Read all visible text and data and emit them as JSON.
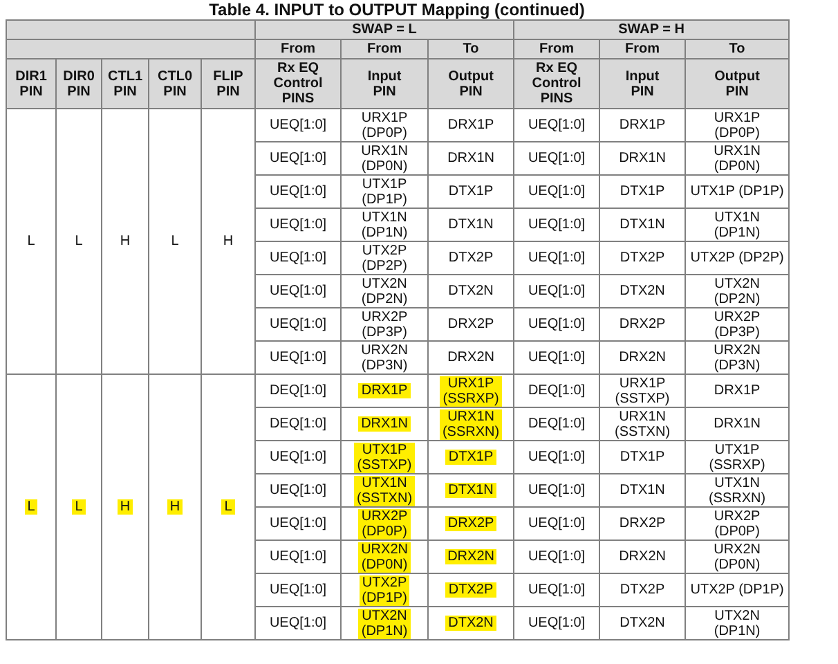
{
  "title": "Table 4. INPUT to OUTPUT Mapping (continued)",
  "swap_groups": [
    "SWAP = L",
    "SWAP = H"
  ],
  "direction_row": [
    "From",
    "From",
    "To",
    "From",
    "From",
    "To"
  ],
  "columns": [
    "DIR1\nPIN",
    "DIR0\nPIN",
    "CTL1\nPIN",
    "CTL0\nPIN",
    "FLIP\nPIN",
    "Rx EQ\nControl\nPINS",
    "Input\nPIN",
    "Output\nPIN",
    "Rx EQ\nControl\nPINS",
    "Input\nPIN",
    "Output\nPIN"
  ],
  "groups": [
    {
      "pins": [
        "L",
        "L",
        "H",
        "L",
        "H"
      ],
      "pins_highlighted": false,
      "rows": [
        {
          "cells": [
            "UEQ[1:0]",
            "URX1P\n(DP0P)",
            "DRX1P",
            "UEQ[1:0]",
            "DRX1P",
            "URX1P\n(DP0P)"
          ],
          "input_highlighted": false,
          "output_highlighted": false
        },
        {
          "cells": [
            "UEQ[1:0]",
            "URX1N\n(DP0N)",
            "DRX1N",
            "UEQ[1:0]",
            "DRX1N",
            "URX1N\n(DP0N)"
          ],
          "input_highlighted": false,
          "output_highlighted": false
        },
        {
          "cells": [
            "UEQ[1:0]",
            "UTX1P\n(DP1P)",
            "DTX1P",
            "UEQ[1:0]",
            "DTX1P",
            "UTX1P (DP1P)"
          ],
          "input_highlighted": false,
          "output_highlighted": false
        },
        {
          "cells": [
            "UEQ[1:0]",
            "UTX1N\n(DP1N)",
            "DTX1N",
            "UEQ[1:0]",
            "DTX1N",
            "UTX1N\n(DP1N)"
          ],
          "input_highlighted": false,
          "output_highlighted": false
        },
        {
          "cells": [
            "UEQ[1:0]",
            "UTX2P\n(DP2P)",
            "DTX2P",
            "UEQ[1:0]",
            "DTX2P",
            "UTX2P (DP2P)"
          ],
          "input_highlighted": false,
          "output_highlighted": false
        },
        {
          "cells": [
            "UEQ[1:0]",
            "UTX2N\n(DP2N)",
            "DTX2N",
            "UEQ[1:0]",
            "DTX2N",
            "UTX2N\n(DP2N)"
          ],
          "input_highlighted": false,
          "output_highlighted": false
        },
        {
          "cells": [
            "UEQ[1:0]",
            "URX2P\n(DP3P)",
            "DRX2P",
            "UEQ[1:0]",
            "DRX2P",
            "URX2P\n(DP3P)"
          ],
          "input_highlighted": false,
          "output_highlighted": false
        },
        {
          "cells": [
            "UEQ[1:0]",
            "URX2N\n(DP3N)",
            "DRX2N",
            "UEQ[1:0]",
            "DRX2N",
            "URX2N\n(DP3N)"
          ],
          "input_highlighted": false,
          "output_highlighted": false
        }
      ]
    },
    {
      "pins": [
        "L",
        "L",
        "H",
        "H",
        "L"
      ],
      "pins_highlighted": true,
      "rows": [
        {
          "cells": [
            "DEQ[1:0]",
            "DRX1P",
            "URX1P\n(SSRXP)",
            "DEQ[1:0]",
            "URX1P\n(SSTXP)",
            "DRX1P"
          ],
          "input_highlighted": true,
          "output_highlighted": true
        },
        {
          "cells": [
            "DEQ[1:0]",
            "DRX1N",
            "URX1N\n(SSRXN)",
            "DEQ[1:0]",
            "URX1N\n(SSTXN)",
            "DRX1N"
          ],
          "input_highlighted": true,
          "output_highlighted": true
        },
        {
          "cells": [
            "UEQ[1:0]",
            "UTX1P\n(SSTXP)",
            "DTX1P",
            "UEQ[1:0]",
            "DTX1P",
            "UTX1P\n(SSRXP)"
          ],
          "input_highlighted": true,
          "output_highlighted": true
        },
        {
          "cells": [
            "UEQ[1:0]",
            "UTX1N\n(SSTXN)",
            "DTX1N",
            "UEQ[1:0]",
            "DTX1N",
            "UTX1N\n(SSRXN)"
          ],
          "input_highlighted": true,
          "output_highlighted": true
        },
        {
          "cells": [
            "UEQ[1:0]",
            "URX2P\n(DP0P)",
            "DRX2P",
            "UEQ[1:0]",
            "DRX2P",
            "URX2P\n(DP0P)"
          ],
          "input_highlighted": true,
          "output_highlighted": true
        },
        {
          "cells": [
            "UEQ[1:0]",
            "URX2N\n(DP0N)",
            "DRX2N",
            "UEQ[1:0]",
            "DRX2N",
            "URX2N\n(DP0N)"
          ],
          "input_highlighted": true,
          "output_highlighted": true
        },
        {
          "cells": [
            "UEQ[1:0]",
            "UTX2P\n(DP1P)",
            "DTX2P",
            "UEQ[1:0]",
            "DTX2P",
            "UTX2P (DP1P)"
          ],
          "input_highlighted": true,
          "output_highlighted": true
        },
        {
          "cells": [
            "UEQ[1:0]",
            "UTX2N\n(DP1N)",
            "DTX2N",
            "UEQ[1:0]",
            "DTX2N",
            "UTX2N\n(DP1N)"
          ],
          "input_highlighted": true,
          "output_highlighted": true
        }
      ]
    }
  ]
}
